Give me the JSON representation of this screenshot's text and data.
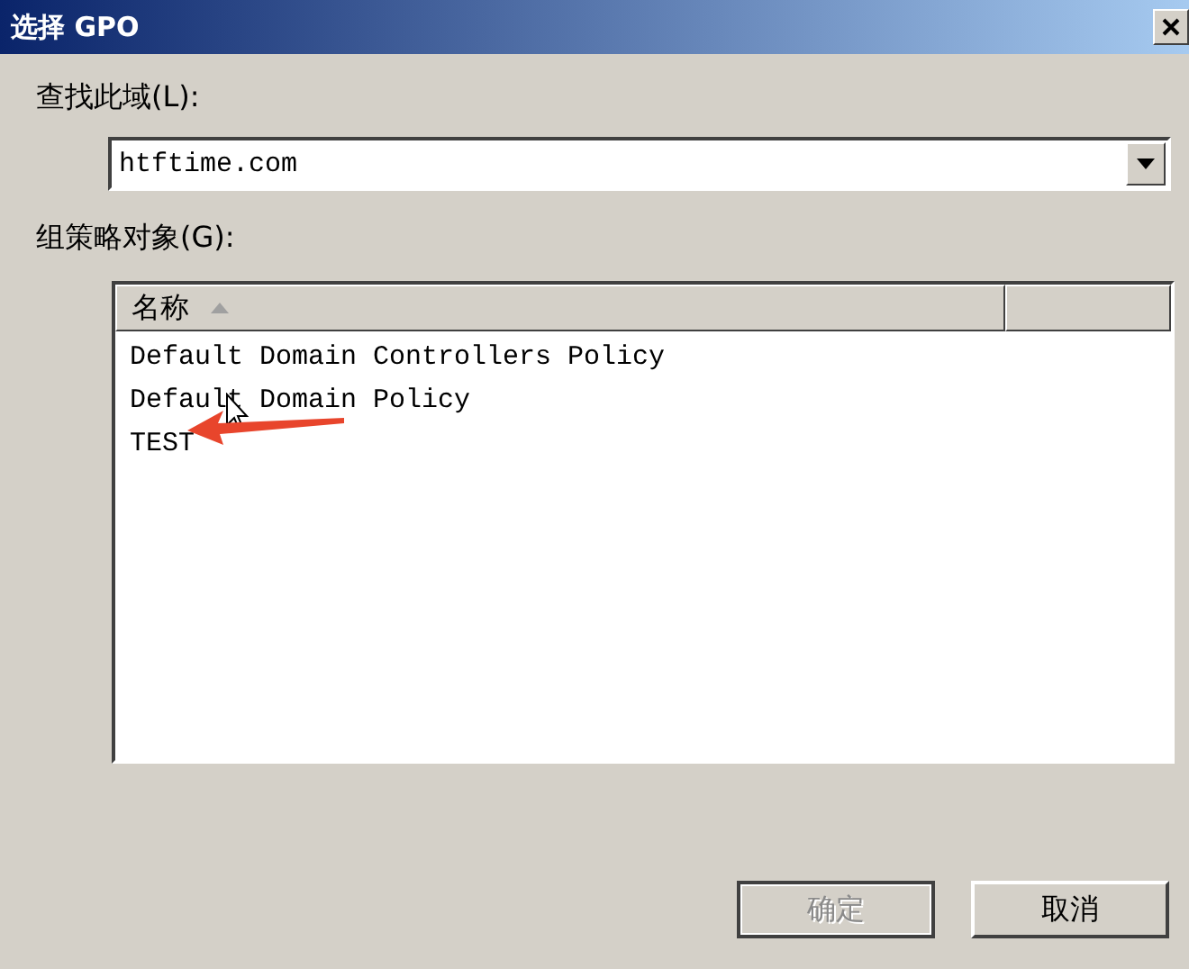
{
  "window": {
    "title": "选择 GPO"
  },
  "domain": {
    "label": "查找此域(L):",
    "value": "htftime.com"
  },
  "gpo_list": {
    "label": "组策略对象(G):",
    "columns": [
      {
        "label": "名称",
        "sorted": true
      },
      {
        "sorted": false
      }
    ],
    "rows": [
      {
        "name": "Default Domain Controllers Policy"
      },
      {
        "name": "Default Domain Policy"
      },
      {
        "name": "TEST"
      }
    ]
  },
  "buttons": [
    {
      "label": "确定",
      "disabled": true
    },
    {
      "label": "取消",
      "disabled": false
    }
  ]
}
